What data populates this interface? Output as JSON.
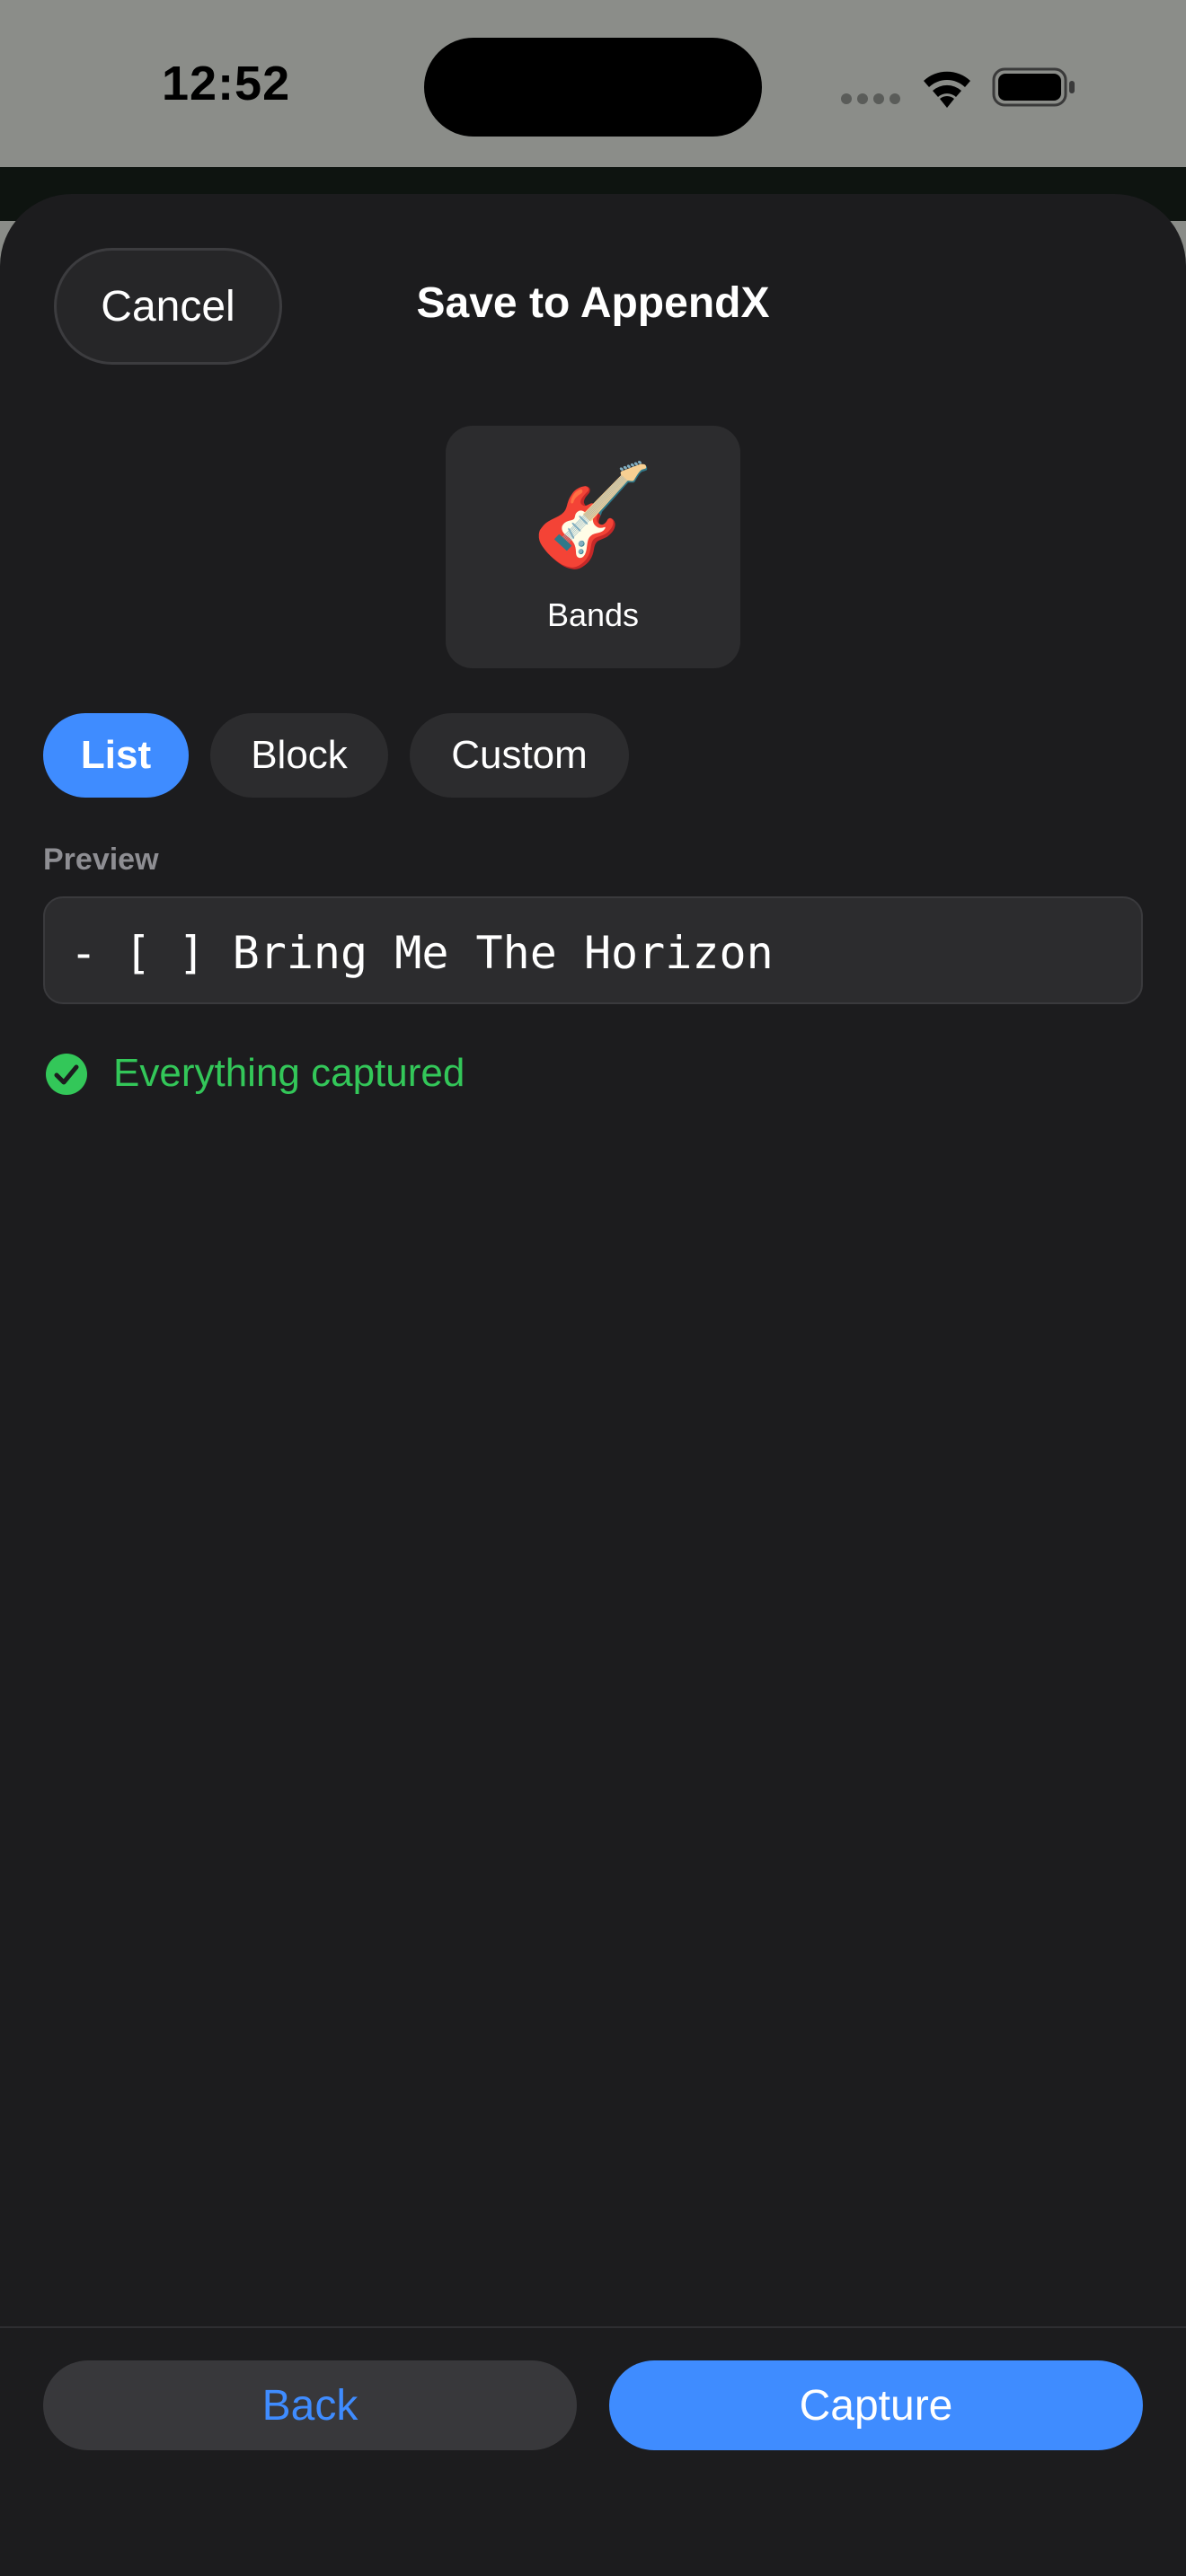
{
  "status_bar": {
    "time": "12:52"
  },
  "header": {
    "cancel_label": "Cancel",
    "title": "Save to AppendX"
  },
  "destination": {
    "emoji": "🎸",
    "label": "Bands"
  },
  "format_chips": [
    {
      "label": "List",
      "selected": true
    },
    {
      "label": "Block",
      "selected": false
    },
    {
      "label": "Custom",
      "selected": false
    }
  ],
  "preview": {
    "label": "Preview",
    "text": "- [ ] Bring Me The Horizon"
  },
  "status": {
    "icon": "check-circle-icon",
    "text": "Everything captured",
    "color": "#33c759"
  },
  "footer": {
    "back_label": "Back",
    "capture_label": "Capture"
  },
  "colors": {
    "accent": "#3f8cff",
    "sheet_background": "#1c1c1e"
  }
}
